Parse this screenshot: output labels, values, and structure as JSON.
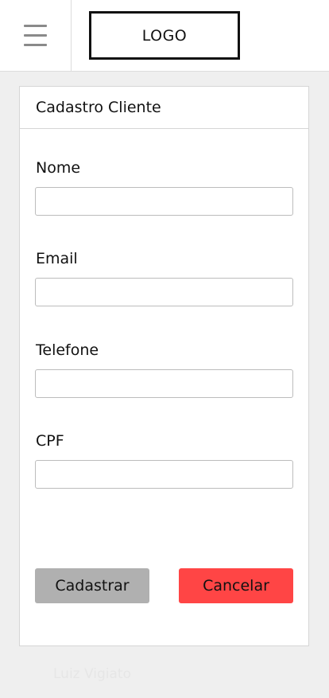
{
  "header": {
    "logo_text": "LOGO",
    "menu_icon": "hamburger-menu-icon"
  },
  "form": {
    "title": "Cadastro Cliente",
    "fields": [
      {
        "label": "Nome",
        "value": "",
        "placeholder": ""
      },
      {
        "label": "Email",
        "value": "",
        "placeholder": ""
      },
      {
        "label": "Telefone",
        "value": "",
        "placeholder": ""
      },
      {
        "label": "CPF",
        "value": "",
        "placeholder": ""
      }
    ],
    "submit_label": "Cadastrar",
    "cancel_label": "Cancelar"
  },
  "footer": {
    "text": "Luiz Vigiato"
  },
  "colors": {
    "background": "#efefef",
    "submit_button": "#b0b0b0",
    "cancel_button": "#ff4545"
  }
}
